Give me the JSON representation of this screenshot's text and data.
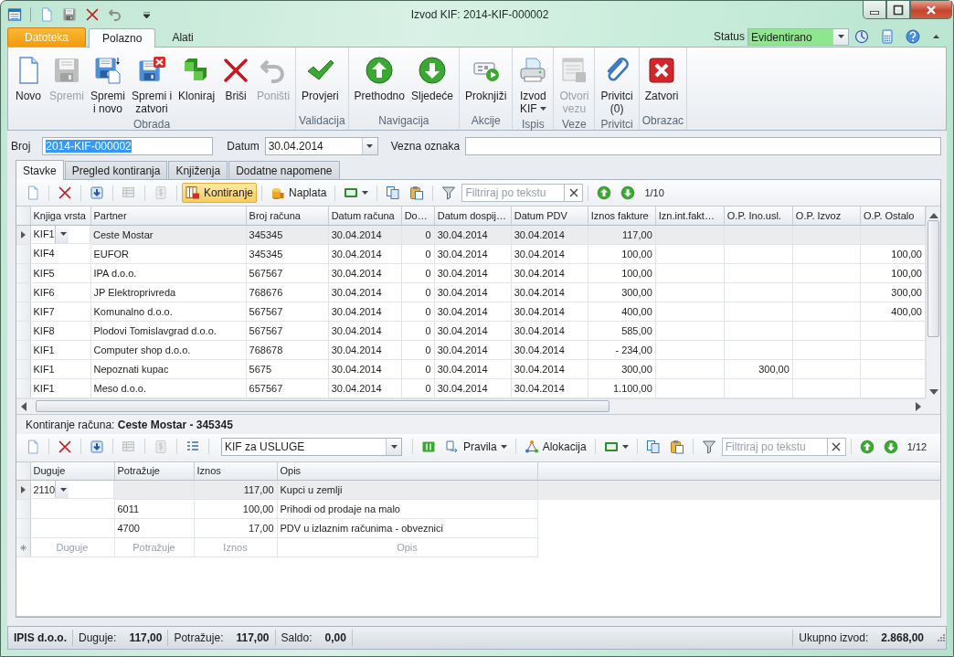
{
  "window": {
    "title": "Izvod KIF: 2014-KIF-000002"
  },
  "ribbon": {
    "tabs": [
      {
        "label": "Datoteka",
        "kind": "file",
        "selected": false
      },
      {
        "label": "Polazno",
        "kind": "tab",
        "selected": true
      },
      {
        "label": "Alati",
        "kind": "tab",
        "selected": false
      }
    ],
    "status": {
      "label": "Status",
      "value": "Evidentirano"
    },
    "groups": [
      {
        "label": "Obrada",
        "buttons": [
          {
            "label": "Novo",
            "disabled": false,
            "dropdown": false
          },
          {
            "label": "Spremi",
            "disabled": true,
            "dropdown": false
          },
          {
            "label": "Spremi\ni novo",
            "disabled": false,
            "dropdown": false
          },
          {
            "label": "Spremi i\nzatvori",
            "disabled": false,
            "dropdown": false
          },
          {
            "label": "Kloniraj",
            "disabled": false,
            "dropdown": false
          },
          {
            "label": "Briši",
            "disabled": false,
            "dropdown": false
          },
          {
            "label": "Poništi",
            "disabled": true,
            "dropdown": false
          }
        ]
      },
      {
        "label": "Validacija",
        "buttons": [
          {
            "label": "Provjeri",
            "disabled": false,
            "dropdown": false
          }
        ]
      },
      {
        "label": "Navigacija",
        "buttons": [
          {
            "label": "Prethodno",
            "disabled": false,
            "dropdown": false
          },
          {
            "label": "Sljedeće",
            "disabled": false,
            "dropdown": false
          }
        ]
      },
      {
        "label": "Akcije",
        "buttons": [
          {
            "label": "Proknjiži",
            "disabled": false,
            "dropdown": false
          }
        ]
      },
      {
        "label": "Ispis",
        "buttons": [
          {
            "label": "Izvod\nKIF",
            "disabled": false,
            "dropdown": true
          }
        ]
      },
      {
        "label": "Veze",
        "buttons": [
          {
            "label": "Otvori\nvezu",
            "disabled": true,
            "dropdown": false
          }
        ]
      },
      {
        "label": "Privitci",
        "buttons": [
          {
            "label": "Privitci\n(0)",
            "disabled": false,
            "dropdown": false
          }
        ]
      },
      {
        "label": "Obrazac",
        "buttons": [
          {
            "label": "Zatvori",
            "disabled": false,
            "dropdown": false
          }
        ]
      }
    ]
  },
  "header": {
    "broj": {
      "label": "Broj",
      "value": "2014-KIF-000002",
      "text_selected": true
    },
    "datum": {
      "label": "Datum",
      "value": "30.04.2014"
    },
    "vezna_oznaka": {
      "label": "Vezna oznaka"
    }
  },
  "tabs": [
    {
      "label": "Stavke",
      "selected": true
    },
    {
      "label": "Pregled kontiranja",
      "selected": false
    },
    {
      "label": "Knjiženja",
      "selected": false
    },
    {
      "label": "Dodatne napomene",
      "selected": false
    }
  ],
  "stavke": {
    "toolbar": {
      "buttons": [
        {
          "label": "Kontiranje",
          "selected": true,
          "dropdown": false
        },
        {
          "label": "Naplata",
          "selected": false,
          "dropdown": false
        }
      ],
      "filter": {
        "placeholder": "Filtriraj po tekstu"
      },
      "counter": "1/10"
    },
    "grid": {
      "columns": [
        {
          "label": "Knjiga vrsta",
          "kind": "text"
        },
        {
          "label": "Partner",
          "kind": "text"
        },
        {
          "label": "Broj računa",
          "kind": "text"
        },
        {
          "label": "Datum računa",
          "kind": "text"
        },
        {
          "label": "Do…",
          "kind": "number"
        },
        {
          "label": "Datum dospij…",
          "kind": "text"
        },
        {
          "label": "Datum PDV",
          "kind": "text"
        },
        {
          "label": "Iznos fakture",
          "kind": "number"
        },
        {
          "label": "Izn.int.fakt…",
          "kind": "number"
        },
        {
          "label": "O.P. Ino.usl.",
          "kind": "number"
        },
        {
          "label": "O.P. Izvoz",
          "kind": "number"
        },
        {
          "label": "O.P. Ostalo",
          "kind": "number"
        }
      ],
      "rows": [
        {
          "selected": true,
          "cells": [
            "KIF1",
            "Ceste Mostar",
            "345345",
            "30.04.2014",
            "0",
            "30.04.2014",
            "30.04.2014",
            "117,00",
            null,
            null,
            null,
            null
          ]
        },
        {
          "selected": false,
          "cells": [
            "KIF4",
            "EUFOR",
            "345345",
            "30.04.2014",
            "0",
            "30.04.2014",
            "30.04.2014",
            "100,00",
            null,
            null,
            null,
            "100,00"
          ]
        },
        {
          "selected": false,
          "cells": [
            "KIF5",
            "IPA d.o.o.",
            "567567",
            "30.04.2014",
            "0",
            "30.04.2014",
            "30.04.2014",
            "100,00",
            null,
            null,
            null,
            "100,00"
          ]
        },
        {
          "selected": false,
          "cells": [
            "KIF6",
            "JP Elektroprivreda",
            "768676",
            "30.04.2014",
            "0",
            "30.04.2014",
            "30.04.2014",
            "300,00",
            null,
            null,
            null,
            "300,00"
          ]
        },
        {
          "selected": false,
          "cells": [
            "KIF7",
            "Komunalno d.o.o.",
            "567567",
            "30.04.2014",
            "0",
            "30.04.2014",
            "30.04.2014",
            "400,00",
            null,
            null,
            null,
            "400,00"
          ]
        },
        {
          "selected": false,
          "cells": [
            "KIF8",
            "Plodovi Tomislavgrad d.o.o.",
            "567567",
            "30.04.2014",
            "0",
            "30.04.2014",
            "30.04.2014",
            "585,00",
            null,
            null,
            null,
            null
          ]
        },
        {
          "selected": false,
          "cells": [
            "KIF1",
            "Computer shop d.o.o.",
            "768678",
            "30.04.2014",
            "0",
            "30.04.2014",
            "30.04.2014",
            "- 234,00",
            null,
            null,
            null,
            null
          ]
        },
        {
          "selected": false,
          "cells": [
            "KIF1",
            "Nepoznati kupac",
            "5675",
            "30.04.2014",
            "0",
            "30.04.2014",
            "30.04.2014",
            "300,00",
            null,
            "300,00",
            null,
            null
          ]
        },
        {
          "selected": false,
          "cells": [
            "KIF1",
            "Meso d.o.o.",
            "657567",
            "30.04.2014",
            "0",
            "30.04.2014",
            "30.04.2014",
            "1.100,00",
            null,
            null,
            null,
            null
          ]
        }
      ]
    }
  },
  "kontiranje": {
    "caption": "Kontiranje računa: **Ceste Mostar - 345345**",
    "toolbar": {
      "combo": {
        "value": "KIF za USLUGE"
      },
      "buttons": [
        {
          "label": "Pravila",
          "selected": false,
          "dropdown": true
        },
        {
          "label": "Alokacija",
          "selected": false,
          "dropdown": false
        }
      ],
      "filter": {
        "placeholder": "Filtriraj po tekstu"
      },
      "counter": "1/12"
    },
    "grid": {
      "columns": [
        {
          "label": "Duguje",
          "kind": "text"
        },
        {
          "label": "Potražuje",
          "kind": "text"
        },
        {
          "label": "Iznos",
          "kind": "number"
        },
        {
          "label": "Opis",
          "kind": "text"
        }
      ],
      "rows": [
        {
          "selected": true,
          "cells": [
            "2110",
            null,
            "117,00",
            "Kupci u zemlji"
          ]
        },
        {
          "selected": false,
          "cells": [
            null,
            "6011",
            "100,00",
            "Prihodi od prodaje na malo"
          ]
        },
        {
          "selected": false,
          "cells": [
            null,
            "4700",
            "17,00",
            "PDV u izlaznim računima - obveznici"
          ]
        }
      ],
      "new_row": [
        "Duguje",
        "Potražuje",
        "Iznos",
        "Opis"
      ]
    }
  },
  "status_bar": {
    "company": "IPIS d.o.o.",
    "totals": [
      {
        "label": "Duguje:",
        "value": "117,00"
      },
      {
        "label": "Potražuje:",
        "value": "117,00"
      },
      {
        "label": "Saldo:",
        "value": "0,00"
      }
    ],
    "grand_total": {
      "label": "Ukupno izvod:",
      "value": "2.868,00"
    }
  }
}
